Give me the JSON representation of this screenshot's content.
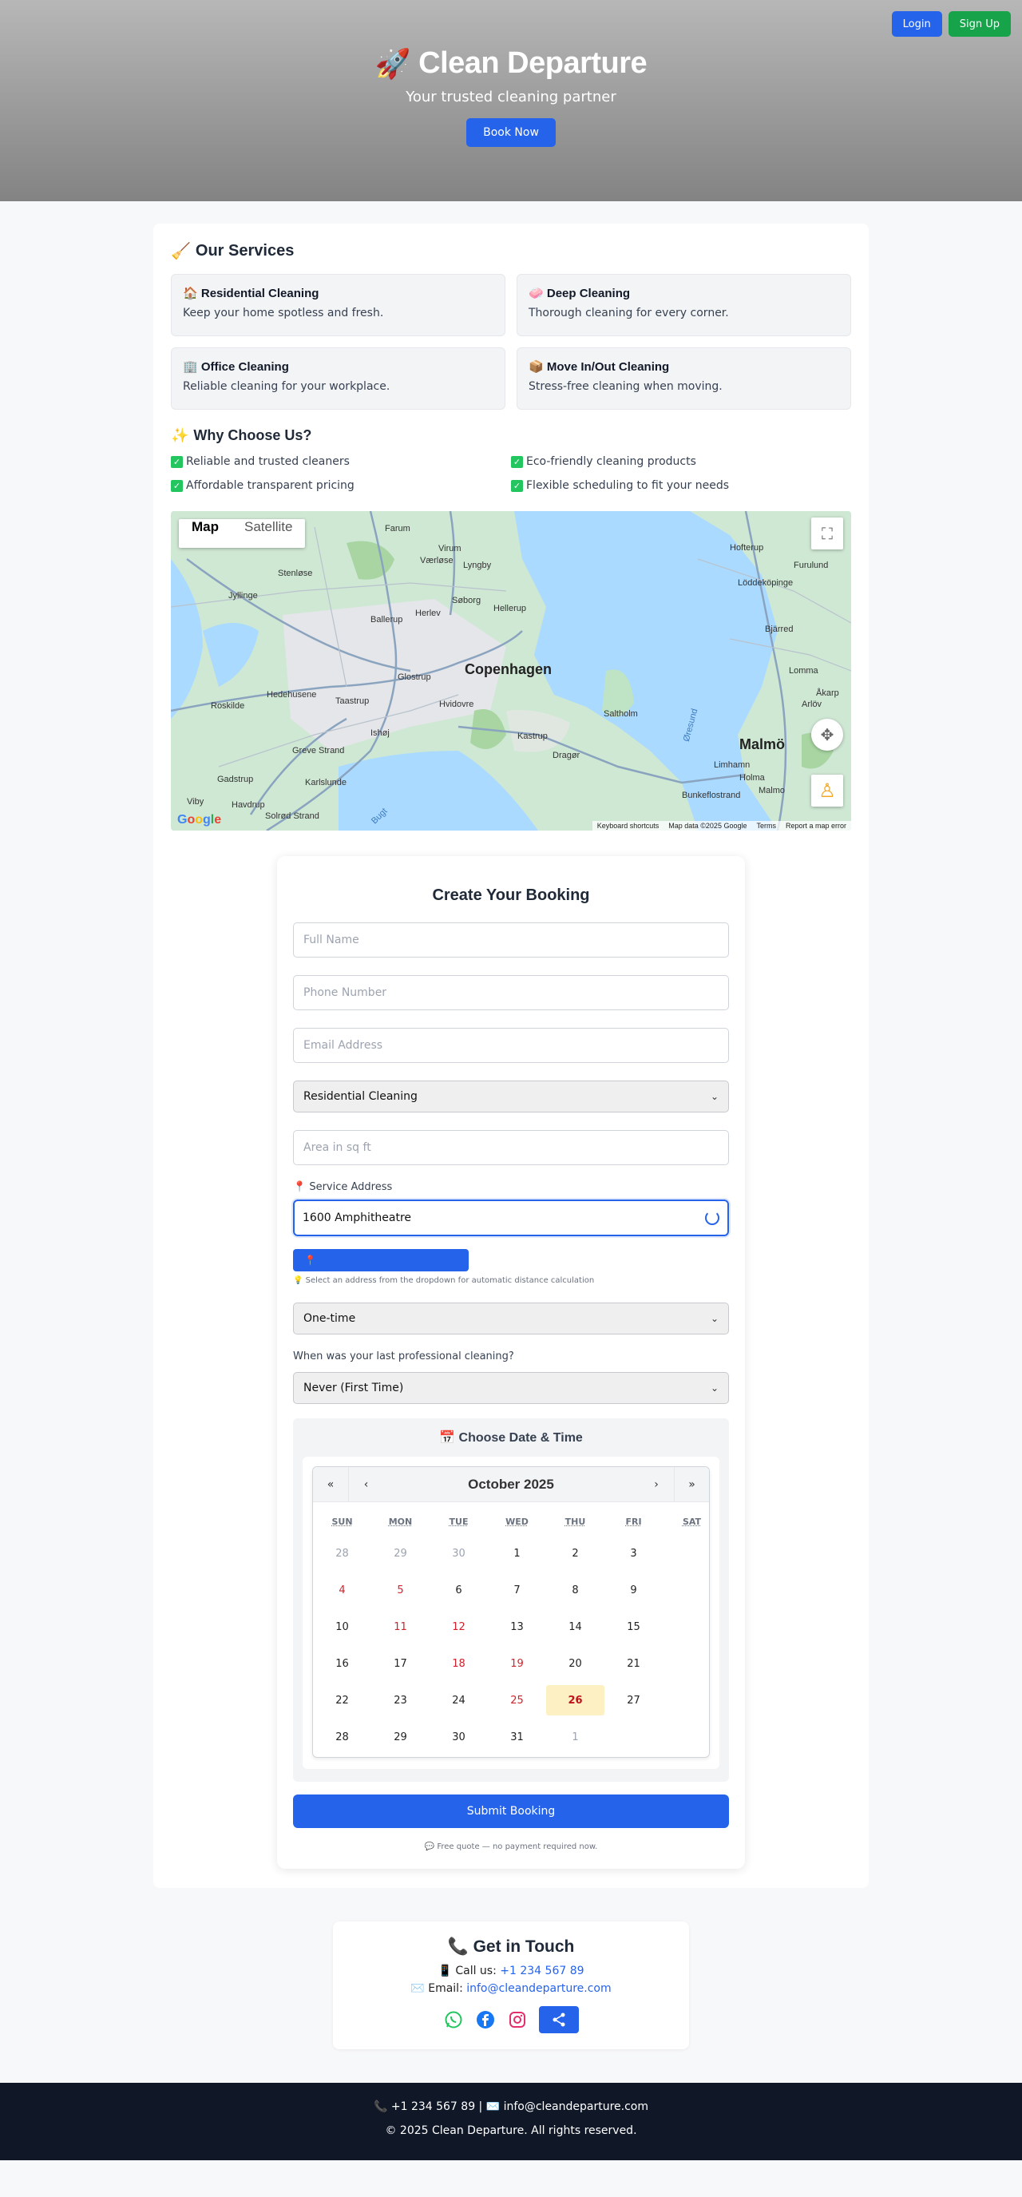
{
  "header": {
    "login_label": "Login",
    "signup_label": "Sign Up",
    "rocket_icon": "🚀",
    "title": "Clean Departure",
    "subtitle": "Your trusted cleaning partner",
    "book_label": "Book Now"
  },
  "services": {
    "icon": "🧹",
    "heading": "Our Services",
    "items": [
      {
        "icon": "🏠",
        "title": "Residential Cleaning",
        "desc": "Keep your home spotless and fresh."
      },
      {
        "icon": "🧼",
        "title": "Deep Cleaning",
        "desc": "Thorough cleaning for every corner."
      },
      {
        "icon": "🏢",
        "title": "Office Cleaning",
        "desc": "Reliable cleaning for your workplace."
      },
      {
        "icon": "📦",
        "title": "Move In/Out Cleaning",
        "desc": "Stress-free cleaning when moving."
      }
    ]
  },
  "why": {
    "icon": "✨",
    "heading": "Why Choose Us?",
    "check_icon": "✓",
    "items": [
      "Reliable and trusted cleaners",
      "Eco-friendly cleaning products",
      "Affordable transparent pricing",
      "Flexible scheduling to fit your needs"
    ]
  },
  "map": {
    "tab_map": "Map",
    "tab_satellite": "Satellite",
    "labels": {
      "copenhagen": "Copenhagen",
      "malmo": "Malmö",
      "farum": "Farum",
      "vaerlose": "Værløse",
      "virum": "Virum",
      "lyngby": "Lyngby",
      "stenlose": "Stenløse",
      "jyllinge": "Jyllinge",
      "soborg": "Søborg",
      "herlev": "Herlev",
      "ballerup": "Ballerup",
      "hellerup": "Hellerup",
      "glostrup": "Glostrup",
      "hedehusene": "Hedehusene",
      "taastrup": "Taastrup",
      "roskilde": "Roskilde",
      "hvidovre": "Hvidovre",
      "ishoj": "Ishøj",
      "kastrup": "Kastrup",
      "saltholm": "Saltholm",
      "dragor": "Dragør",
      "greve": "Greve Strand",
      "karlslunde": "Karlslunde",
      "gadstrup": "Gadstrup",
      "havdrup": "Havdrup",
      "viby": "Viby",
      "solrod": "Solrød Strand",
      "hofterup": "Hofterup",
      "furulund": "Furulund",
      "loddekopinge": "Löddeköpinge",
      "bjarred": "Bjärred",
      "lomma": "Lomma",
      "arlov": "Arlöv",
      "akarp": "Åkarp",
      "limhamn": "Limhamn",
      "holma": "Holma",
      "malmo_small": "Malmo",
      "bunkeflostrand": "Bunkeflostrand",
      "oresund": "Øresund",
      "koge_bugt": "Bugt"
    },
    "footer": {
      "keyboard": "Keyboard shortcuts",
      "mapdata": "Map data ©2025 Google",
      "terms": "Terms",
      "report": "Report a map error"
    },
    "google": "Google",
    "fullscreen_icon": "fullscreen-icon",
    "pegman_icon": "pegman-icon"
  },
  "form": {
    "title": "Create Your Booking",
    "name_placeholder": "Full Name",
    "phone_placeholder": "Phone Number",
    "email_placeholder": "Email Address",
    "service_value": "Residential Cleaning",
    "area_placeholder": "Area in sq ft",
    "address_label": "📍 Service Address",
    "address_value": "1600 Amphitheatre",
    "pin_icon": "📍",
    "hint": "💡 Select an address from the dropdown for automatic distance calculation",
    "frequency_value": "One-time",
    "last_cleaning_question": "When was your last professional cleaning?",
    "last_cleaning_value": "Never (First Time)",
    "submit_label": "Submit Booking",
    "free_note": "💬 Free quote — no payment required now."
  },
  "calendar": {
    "heading": "📅 Choose Date & Time",
    "month": "October 2025",
    "prev_year": "«",
    "prev_month": "‹",
    "next_month": "›",
    "next_year": "»",
    "weekdays": [
      "SUN",
      "MON",
      "TUE",
      "WED",
      "THU",
      "FRI",
      "SAT"
    ],
    "weeks": [
      [
        "28",
        "29",
        "30",
        "1",
        "2",
        "3",
        ""
      ],
      [
        "4",
        "5",
        "6",
        "7",
        "8",
        "9",
        ""
      ],
      [
        "10",
        "11",
        "12",
        "13",
        "14",
        "15",
        ""
      ],
      [
        "16",
        "17",
        "18",
        "19",
        "20",
        "21",
        ""
      ],
      [
        "22",
        "23",
        "24",
        "25",
        "26",
        "27",
        ""
      ],
      [
        "28",
        "29",
        "30",
        "31",
        "1",
        "",
        ""
      ]
    ],
    "muted_cells": [
      "0-0",
      "0-1",
      "0-2",
      "5-4"
    ],
    "red_cells": [
      "1-0",
      "1-1",
      "2-1",
      "2-2",
      "3-2",
      "3-3",
      "4-3"
    ],
    "today_cell": "4-4"
  },
  "contact": {
    "heading": "📞 Get in Touch",
    "call_prefix": "📱 Call us: ",
    "phone": "+1 234 567 89",
    "email_prefix": "✉️ Email: ",
    "email": "info@cleandeparture.com",
    "social_icons": [
      "whatsapp-icon",
      "facebook-icon",
      "instagram-icon",
      "share-icon"
    ]
  },
  "footer": {
    "line1": "📞 +1 234 567 89 | ✉️ info@cleandeparture.com",
    "line2": "© 2025 Clean Departure. All rights reserved."
  },
  "colors": {
    "primary": "#2563eb",
    "success": "#16a34a",
    "footer_bg": "#101828",
    "today_bg": "#fdf0c2",
    "red_day": "#d1222b"
  }
}
